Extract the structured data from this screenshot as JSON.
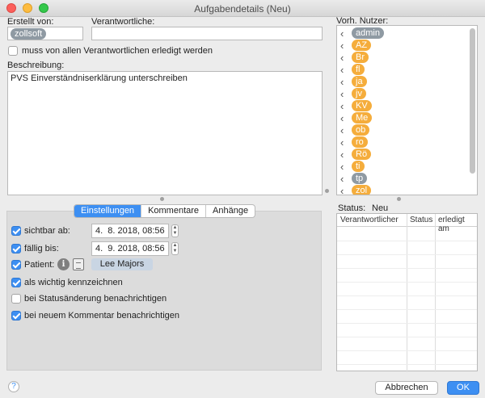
{
  "window": {
    "title": "Aufgabendetails (Neu)"
  },
  "creator": {
    "label": "Erstellt von:",
    "user": "zollsoft"
  },
  "responsible": {
    "label": "Verantwortliche:",
    "value": ""
  },
  "all_required": {
    "label": "muss von allen Verantwortlichen erledigt werden",
    "checked": false
  },
  "description": {
    "label": "Beschreibung:",
    "text": "PVS Einverständniserklärung unterschreiben"
  },
  "users": {
    "label": "Vorh. Nutzer:",
    "items": [
      {
        "name": "admin",
        "color": "#8f9aa3"
      },
      {
        "name": "AZ",
        "color": "#f5ad3c"
      },
      {
        "name": "Br",
        "color": "#f5ad3c"
      },
      {
        "name": "fl",
        "color": "#f5ad3c"
      },
      {
        "name": "ja",
        "color": "#f5ad3c"
      },
      {
        "name": "jv",
        "color": "#f5ad3c"
      },
      {
        "name": "KV",
        "color": "#f5ad3c"
      },
      {
        "name": "Me",
        "color": "#f5ad3c"
      },
      {
        "name": "ob",
        "color": "#f5ad3c"
      },
      {
        "name": "ro",
        "color": "#f5ad3c"
      },
      {
        "name": "Rö",
        "color": "#f5ad3c"
      },
      {
        "name": "ti",
        "color": "#f5ad3c"
      },
      {
        "name": "tp",
        "color": "#8f9aa3"
      },
      {
        "name": "zol",
        "color": "#f5ad3c"
      }
    ]
  },
  "tabs": [
    {
      "label": "Einstellungen",
      "active": true
    },
    {
      "label": "Kommentare",
      "active": false
    },
    {
      "label": "Anhänge",
      "active": false
    }
  ],
  "settings": {
    "visible_from": {
      "label": "sichtbar ab:",
      "value": "4.  8. 2018, 08:56",
      "checked": true
    },
    "due": {
      "label": "fällig bis:",
      "value": "4.  9. 2018, 08:56",
      "checked": true
    },
    "patient": {
      "label": "Patient:",
      "name": "Lee Majors",
      "checked": true
    },
    "important": {
      "label": "als wichtig kennzeichnen",
      "checked": true
    },
    "notify_status": {
      "label": "bei Statusänderung benachrichtigen",
      "checked": false
    },
    "notify_comment": {
      "label": "bei neuem Kommentar benachrichtigen",
      "checked": true
    }
  },
  "status": {
    "label": "Status:",
    "value": "Neu",
    "columns": [
      "Verantwortlicher",
      "Status",
      "erledigt am"
    ]
  },
  "buttons": {
    "cancel": "Abbrechen",
    "ok": "OK",
    "help": "?"
  },
  "colors": {
    "accent": "#3d8ff2",
    "user_orange": "#f5ad3c",
    "user_gray": "#8f9aa3"
  }
}
